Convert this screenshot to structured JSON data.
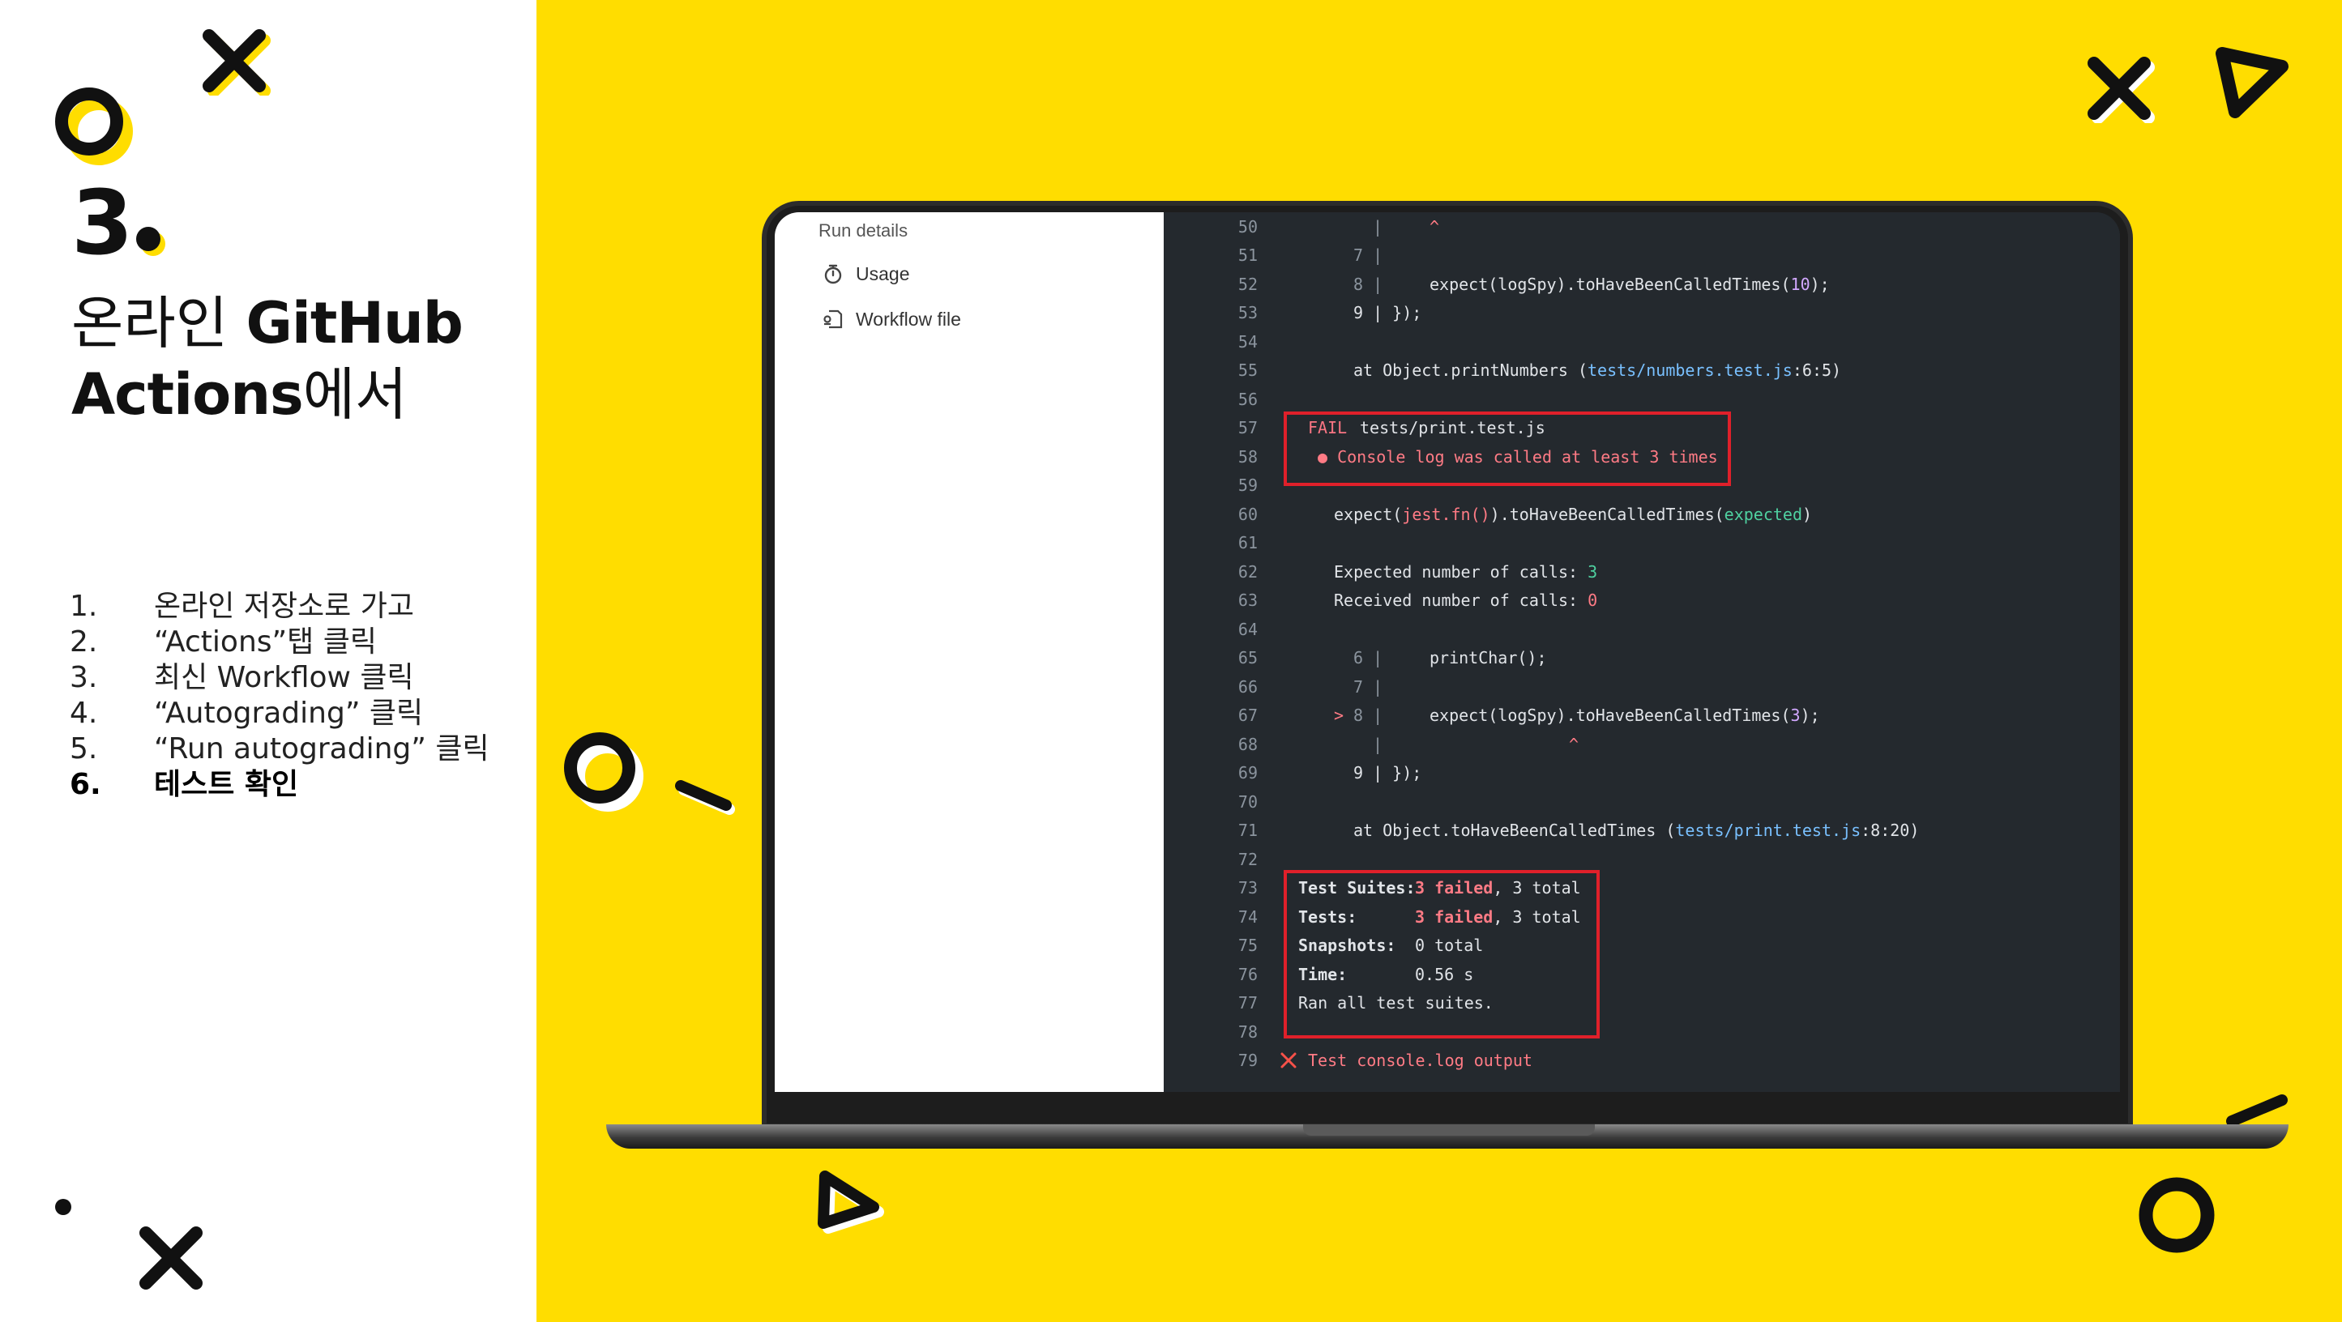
{
  "slide": {
    "number": "3",
    "title_light_1": "온라인 ",
    "title_bold_1": "GitHub",
    "title_bold_2": "Actions",
    "title_light_2": "에서",
    "steps": [
      {
        "num": "1.",
        "text": "온라인 저장소로 가고"
      },
      {
        "num": "2.",
        "text": "“Actions”탭 클릭"
      },
      {
        "num": "3.",
        "text": "최신 Workflow 클릭"
      },
      {
        "num": "4.",
        "text": "“Autograding” 클릭"
      },
      {
        "num": "5.",
        "text": "“Run autograding” 클릭"
      },
      {
        "num": "6.",
        "text": "테스트 확인"
      }
    ]
  },
  "sidebar": {
    "heading": "Run details",
    "items": [
      {
        "label": "Usage",
        "icon": "stopwatch-icon"
      },
      {
        "label": "Workflow file",
        "icon": "workflow-file-icon"
      }
    ]
  },
  "terminal": {
    "lines": {
      "l50": {
        "n": "50",
        "a": "|",
        "b": "^"
      },
      "l51": {
        "n": "51",
        "a": "7 |"
      },
      "l52": {
        "n": "52",
        "a": "8 |",
        "b": "expect(logSpy).toHaveBeenCalledTimes(",
        "num": "10",
        "c": ");"
      },
      "l53": {
        "n": "53",
        "a": "9 | });"
      },
      "l54": {
        "n": "54"
      },
      "l55": {
        "n": "55",
        "a": "at Object.printNumbers (",
        "path": "tests/numbers.test.js",
        "c": ":6:5)"
      },
      "l56": {
        "n": "56"
      },
      "l57": {
        "n": "57",
        "fail": "FAIL",
        "file": "tests/print.test.js"
      },
      "l58": {
        "n": "58",
        "msg": "● Console log was called at least 3 times"
      },
      "l59": {
        "n": "59"
      },
      "l60": {
        "n": "60",
        "a": "expect(",
        "fn": "jest.fn()",
        "b": ").toHaveBeenCalledTimes(",
        "exp": "expected",
        "c": ")"
      },
      "l61": {
        "n": "61"
      },
      "l62": {
        "n": "62",
        "a": "Expected number of calls: ",
        "val": "3"
      },
      "l63": {
        "n": "63",
        "a": "Received number of calls: ",
        "val": "0"
      },
      "l64": {
        "n": "64"
      },
      "l65": {
        "n": "65",
        "a": "6 |",
        "b": "printChar();"
      },
      "l66": {
        "n": "66",
        "a": "7 |"
      },
      "l67": {
        "n": "67",
        "arrow": ">",
        "a": "8 |",
        "b": "expect(logSpy).toHaveBeenCalledTimes(",
        "num": "3",
        "c": ");"
      },
      "l68": {
        "n": "68",
        "a": "|",
        "b": "^"
      },
      "l69": {
        "n": "69",
        "a": "9 | });"
      },
      "l70": {
        "n": "70"
      },
      "l71": {
        "n": "71",
        "a": "at Object.toHaveBeenCalledTimes (",
        "path": "tests/print.test.js",
        "c": ":8:20)"
      },
      "l72": {
        "n": "72"
      },
      "l73": {
        "n": "73",
        "label": "Test Suites:",
        "failed": "3 failed",
        "rest": ", 3 total"
      },
      "l74": {
        "n": "74",
        "label": "Tests:",
        "failed": "3 failed",
        "rest": ", 3 total"
      },
      "l75": {
        "n": "75",
        "label": "Snapshots:",
        "rest": "0 total"
      },
      "l76": {
        "n": "76",
        "label": "Time:",
        "rest": "0.56 s"
      },
      "l77": {
        "n": "77",
        "a": "Ran all test suites."
      },
      "l78": {
        "n": "78"
      },
      "l79": {
        "n": "79",
        "a": "Test console.log output"
      }
    }
  },
  "colors": {
    "yellow": "#ffdd00",
    "terminal_bg": "#24292e",
    "highlight_box": "#e0202a"
  }
}
